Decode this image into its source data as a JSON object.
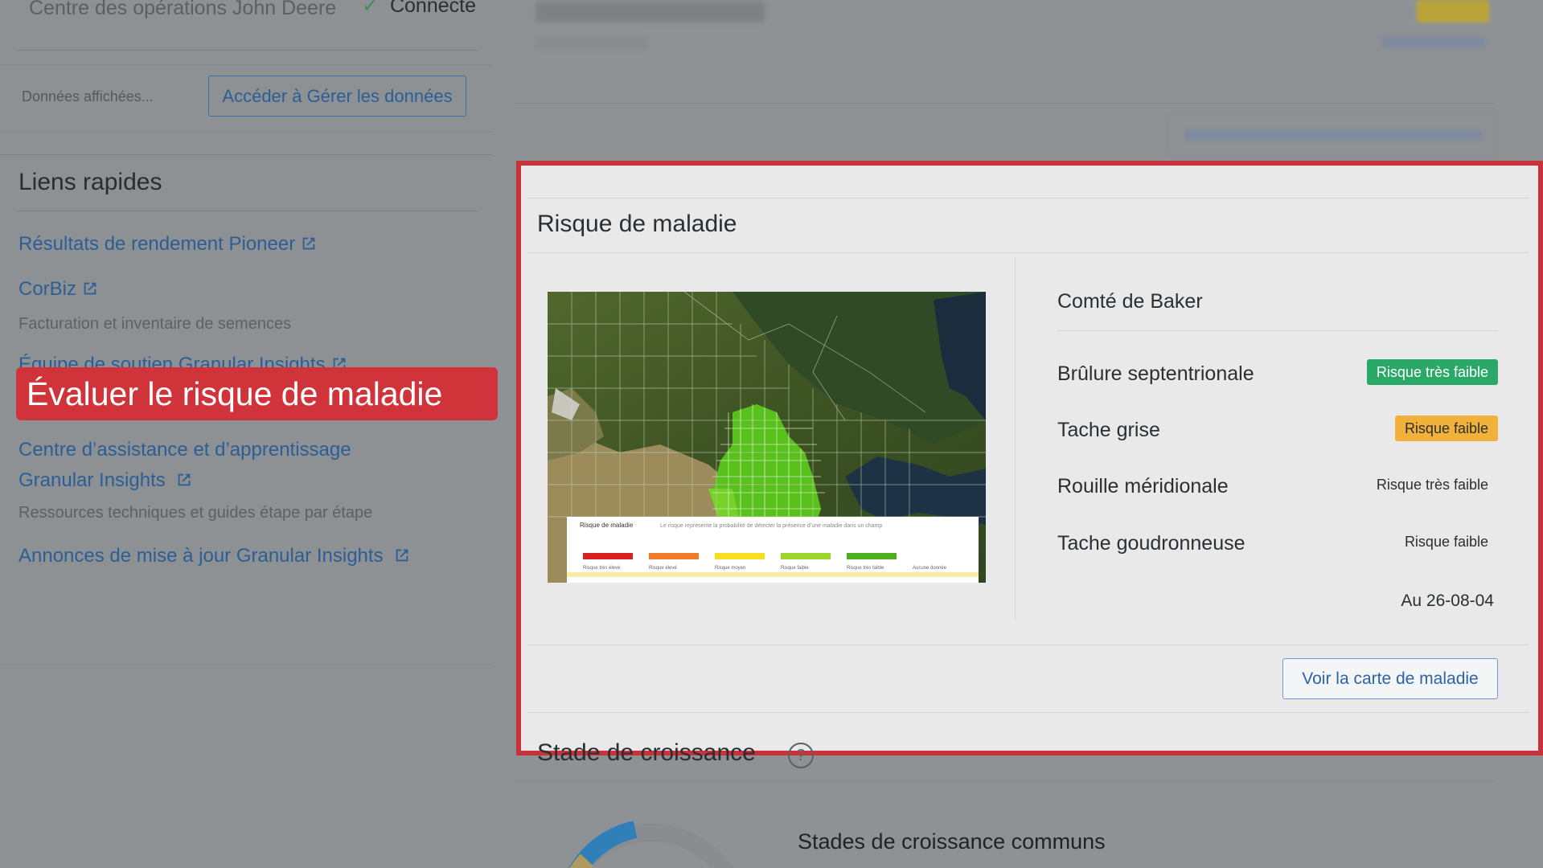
{
  "header": {
    "ops_center": "Centre des opérations John Deere",
    "status": "Connecté",
    "data_label": "Données affichées...",
    "manage_button": "Accéder à Gérer les données"
  },
  "quick_links": {
    "title": "Liens rapides",
    "items": [
      {
        "label": "Résultats de rendement Pioneer",
        "icon": "external-link-icon"
      },
      {
        "label": "CorBiz",
        "icon": "external-link-icon",
        "sub": "Facturation et inventaire de semences"
      },
      {
        "label": "Équipe de soutien Granular Insights",
        "icon": "external-link-icon"
      },
      {
        "label_line1": "Centre d’assistance et d’apprentissage",
        "label_line2": "Granular Insights",
        "icon": "external-link-icon",
        "sub": "Ressources techniques et guides étape par étape"
      },
      {
        "label": "Annonces de mise à jour Granular Insights",
        "icon": "external-link-icon"
      }
    ]
  },
  "callout": "Évaluer le risque de maladie",
  "disease_card": {
    "title": "Risque de maladie",
    "county": "Comté de Baker",
    "risks": [
      {
        "name": "Brûlure septentrionale",
        "level": "Risque très faible",
        "style": "green"
      },
      {
        "name": "Tache grise",
        "level": "Risque faible",
        "style": "orange"
      },
      {
        "name": "Rouille méridionale",
        "level": "Risque très faible",
        "style": "plain"
      },
      {
        "name": "Tache goudronneuse",
        "level": "Risque faible",
        "style": "plain"
      }
    ],
    "as_of": "Au 26-08-04",
    "map_button": "Voir la carte de maladie",
    "map_legend": {
      "title": "Risque de maladie",
      "note": "Le risque représente la probabilité de détecter la présence d’une maladie dans un champ",
      "items": [
        {
          "label": "Risque très élevé",
          "color": "#d92020"
        },
        {
          "label": "Risque élevé",
          "color": "#f07a2a"
        },
        {
          "label": "Risque moyen",
          "color": "#f5df22"
        },
        {
          "label": "Risque faible",
          "color": "#9ad62a"
        },
        {
          "label": "Risque très faible",
          "color": "#4caf1c"
        },
        {
          "label": "Aucune donnée",
          "color": "#ffffff"
        }
      ]
    }
  },
  "growth": {
    "title": "Stade de croissance",
    "subtitle": "Stades de croissance communs"
  },
  "colors": {
    "accent_red": "#d0343a",
    "link_blue": "#2c5e96",
    "badge_green": "#2aa868",
    "badge_orange": "#f2b13a"
  }
}
